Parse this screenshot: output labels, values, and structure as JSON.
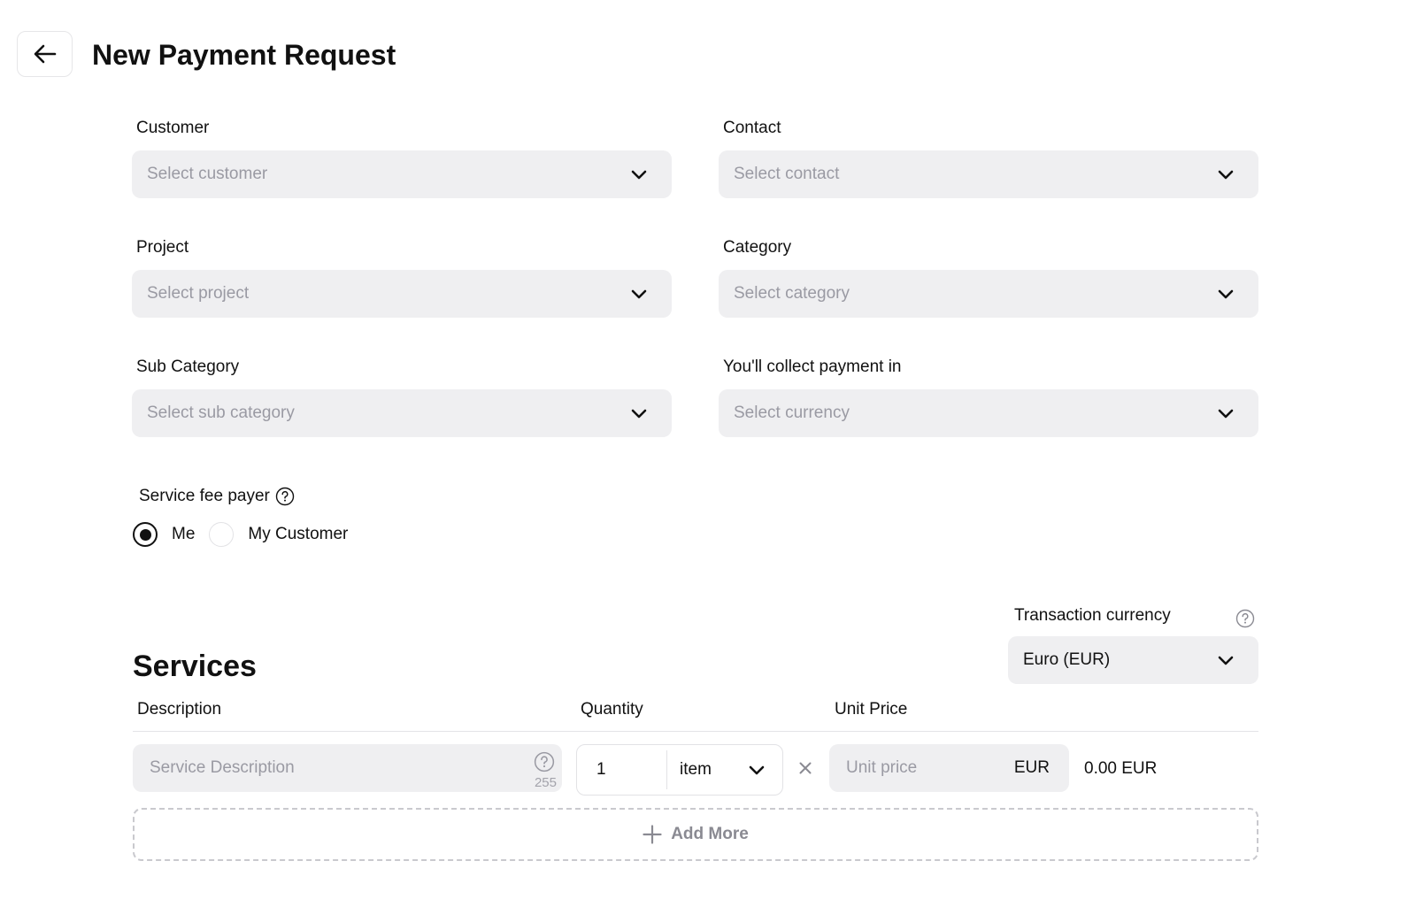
{
  "header": {
    "title": "New Payment Request"
  },
  "form": {
    "customer": {
      "label": "Customer",
      "placeholder": "Select customer"
    },
    "contact": {
      "label": "Contact",
      "placeholder": "Select contact"
    },
    "project": {
      "label": "Project",
      "placeholder": "Select project"
    },
    "category": {
      "label": "Category",
      "placeholder": "Select category"
    },
    "sub_category": {
      "label": "Sub Category",
      "placeholder": "Select sub category"
    },
    "collect_currency": {
      "label": "You'll collect payment in",
      "placeholder": "Select currency"
    },
    "service_fee": {
      "label": "Service fee payer",
      "options": [
        {
          "label": "Me",
          "selected": true
        },
        {
          "label": "My Customer",
          "selected": false
        }
      ]
    }
  },
  "transaction_currency": {
    "label": "Transaction currency",
    "value": "Euro (EUR)"
  },
  "services": {
    "title": "Services",
    "columns": {
      "description": "Description",
      "quantity": "Quantity",
      "unit_price": "Unit Price"
    },
    "rows": [
      {
        "description_placeholder": "Service Description",
        "char_limit": "255",
        "quantity": "1",
        "unit": "item",
        "unit_price_placeholder": "Unit price",
        "currency": "EUR",
        "total": "0.00 EUR"
      }
    ],
    "add_more_label": "Add More"
  },
  "colors": {
    "input_bg": "#efeff1",
    "placeholder": "#9a9aa3",
    "text": "#111111",
    "border": "#e2e2e5"
  },
  "icons": [
    "arrow-left-icon",
    "chevron-down-icon",
    "help-icon",
    "times-icon",
    "plus-icon"
  ]
}
